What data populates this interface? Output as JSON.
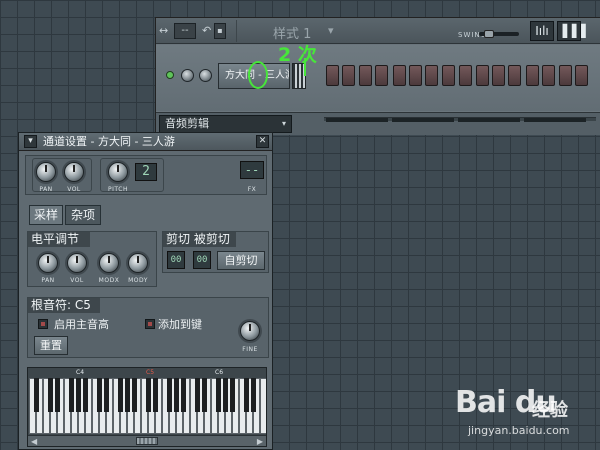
{
  "sequencer": {
    "pattern_value": "--",
    "pattern_label": "样式 1",
    "pattern_arrow": "▾",
    "swing_label": "SWING",
    "swing_level": 0.15,
    "toolbar_icon_1": "Iılı",
    "toolbar_icon_2": "▐▐▐",
    "channel_name": "方大同 - 三人游",
    "dropdown_label": "音频剪辑",
    "dropdown_arrow": "▾",
    "step_count": 16
  },
  "annotation": {
    "text": "2 次",
    "color": "#47e63a"
  },
  "channel_settings": {
    "title": "通道设置 - 方大同 - 三人游",
    "close_label": "✕",
    "menu_label": "▾",
    "knobs_top": [
      "PAN",
      "VOL",
      "PITCH"
    ],
    "pitch_value": "2",
    "fx_value": "--",
    "fx_label": "FX",
    "tabs": [
      "采样",
      "杂项"
    ],
    "level_section": {
      "title": "电平调节",
      "knobs": [
        "PAN",
        "VOL",
        "MODX",
        "MODY"
      ]
    },
    "cut_section": {
      "title": "剪切 被剪切",
      "lcd1": "00",
      "lcd2": "00",
      "auto_cut": "自剪切"
    },
    "root_note": {
      "title": "根音符: C5",
      "main_pitch": "启用主音高",
      "add_to_key": "添加到键",
      "fine_label": "FINE",
      "reset": "重置"
    },
    "keyboard": {
      "octaves": [
        "C4",
        "C5",
        "C6"
      ],
      "selected_octave": "C5",
      "selected_color": "#e35b4a"
    }
  },
  "watermark": {
    "logo": "Bai du",
    "logo_cn": "经验",
    "url": "jingyan.baidu.com"
  }
}
